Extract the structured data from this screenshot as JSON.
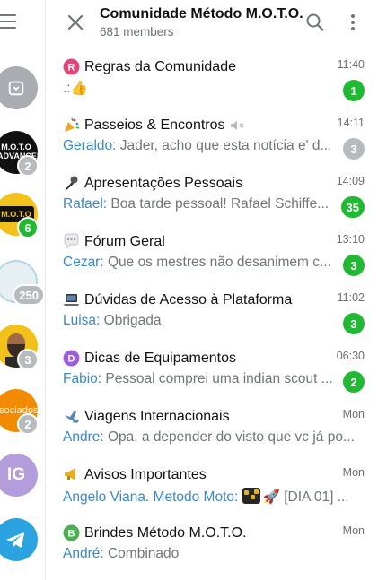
{
  "header": {
    "title": "Comunidade Método M.O.T.O.",
    "subtitle": "681 members"
  },
  "rail": {
    "items": [
      {
        "icon": "archive-icon",
        "badge": ""
      },
      {
        "label": "M.O.T.O ADVANCED",
        "badge": "2"
      },
      {
        "label": "M.O.T.O",
        "badge": "6"
      },
      {
        "badge": "250"
      },
      {
        "badge": "3"
      },
      {
        "label": "ssociados",
        "badge": "2"
      },
      {
        "initials": "IG",
        "badge": ""
      },
      {
        "icon": "telegram-icon",
        "badge": ""
      }
    ]
  },
  "chats": [
    {
      "icon": "letter-r-icon",
      "icon_letter": "R",
      "name": "Regras da Comunidade",
      "time": "11:40",
      "sender": "",
      "message": ".:👍",
      "badge": "1",
      "badge_color": "green"
    },
    {
      "icon": "party-popper-icon",
      "name": "Passeios & Encontros",
      "muted": true,
      "time": "14:11",
      "sender": "Geraldo:",
      "message": " Jader, acho que esta notícia e' d...",
      "badge": "3",
      "badge_color": "grey"
    },
    {
      "icon": "microphone-icon",
      "name": "Apresentações Pessoais",
      "time": "14:09",
      "sender": "Rafael:",
      "message": " Boa tarde pessoal! Rafael Schiffe...",
      "badge": "35",
      "badge_color": "green"
    },
    {
      "icon": "speech-bubble-icon",
      "name": "Fórum Geral",
      "time": "13:10",
      "sender": "Cezar:",
      "message": " Que os mestres não desanimem c...",
      "badge": "3",
      "badge_color": "green"
    },
    {
      "icon": "laptop-icon",
      "name": "Dúvidas de Acesso à Plataforma",
      "time": "11:02",
      "sender": "Luisa:",
      "message": " Obrigada",
      "badge": "3",
      "badge_color": "green"
    },
    {
      "icon": "letter-d-icon",
      "icon_letter": "D",
      "name": "Dicas de Equipamentos",
      "time": "06:30",
      "sender": "Fabio:",
      "message": " Pessoal comprei uma indian scout ...",
      "badge": "2",
      "badge_color": "green"
    },
    {
      "icon": "airplane-icon",
      "name": "Viagens Internacionais",
      "time": "Mon",
      "sender": "Andre:",
      "message": " Opa, a depender do visto que vc já po...",
      "badge": "",
      "badge_color": ""
    },
    {
      "icon": "megaphone-icon",
      "name": "Avisos Importantes",
      "time": "Mon",
      "sender": "Angelo Viana. Metodo Moto:",
      "message": "🚀 [DIA 01] ...",
      "badge": "",
      "badge_color": ""
    },
    {
      "icon": "letter-b-icon",
      "icon_letter": "B",
      "name": "Brindes Método M.O.T.O.",
      "time": "Mon",
      "sender": "André:",
      "message": " Combinado",
      "badge": "",
      "badge_color": ""
    }
  ],
  "colors": {
    "accent_blue": "#3a88c8",
    "badge_green": "#21b834",
    "badge_grey": "#b8bbbe",
    "telegram_blue": "#2aa3e0"
  }
}
